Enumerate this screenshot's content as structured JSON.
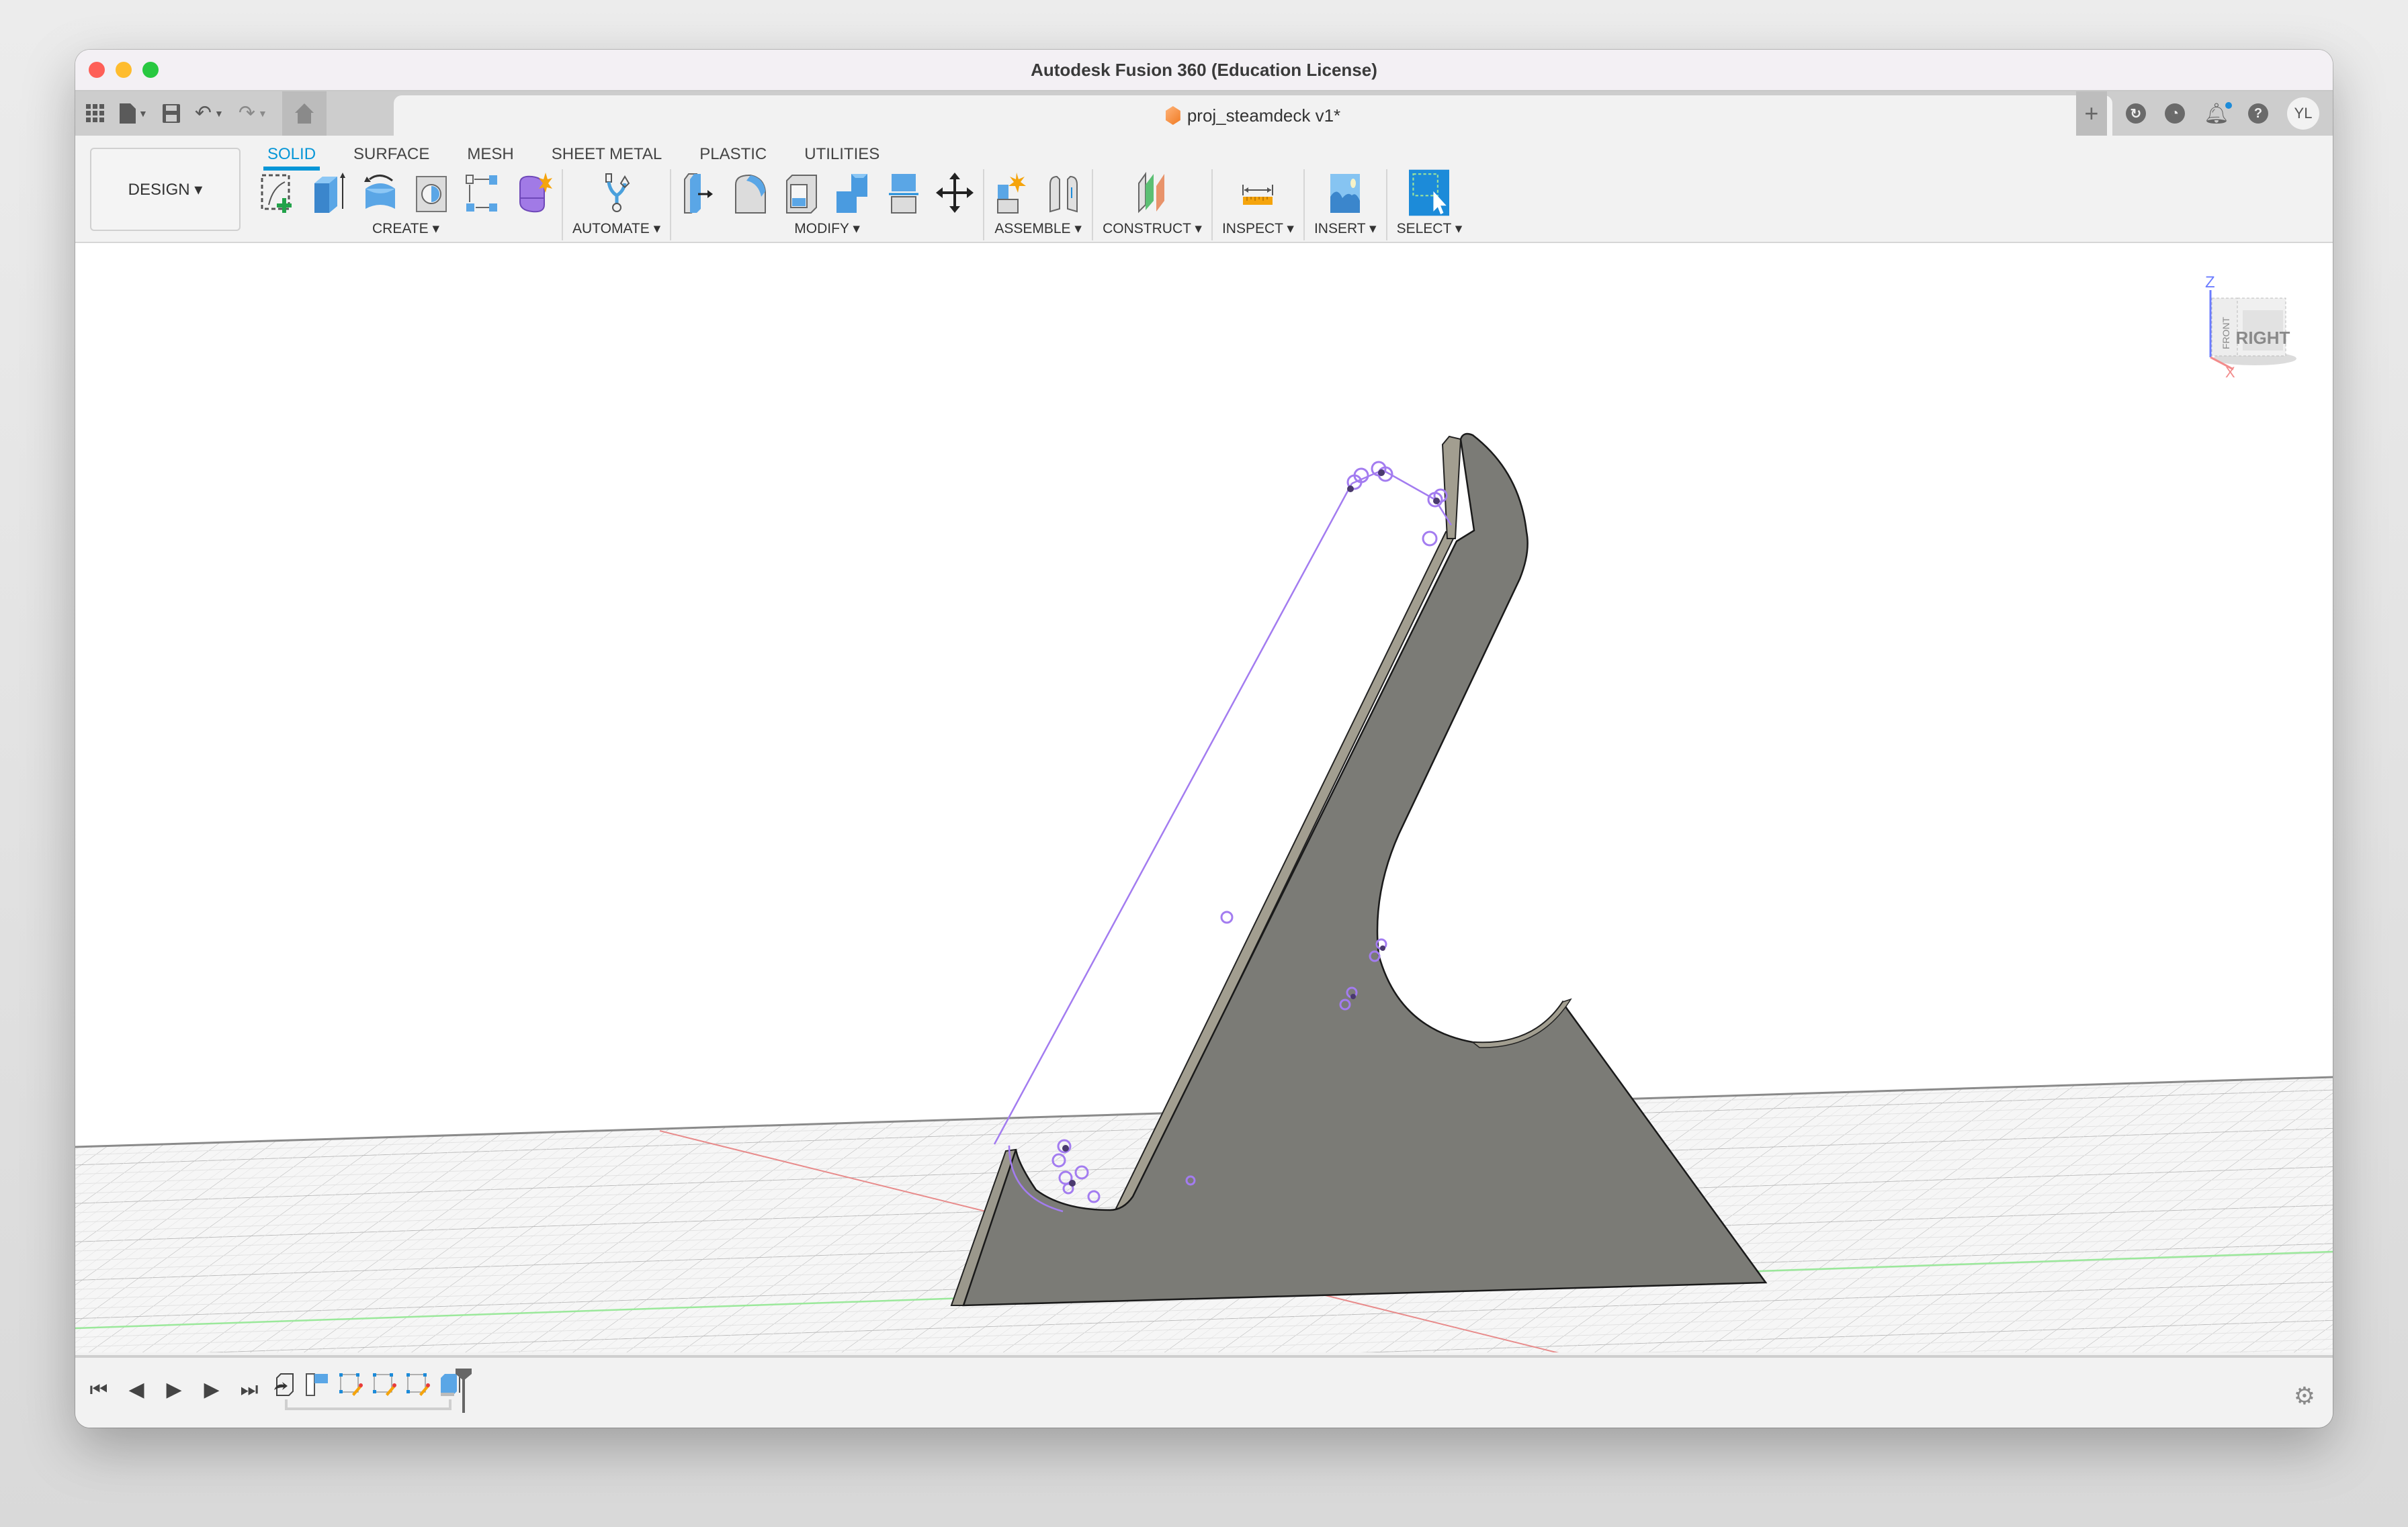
{
  "window": {
    "title": "Autodesk Fusion 360 (Education License)",
    "traffic_lights": [
      "close",
      "minimize",
      "zoom"
    ]
  },
  "tabbar": {
    "left_icons": [
      "apps-grid-icon",
      "file-icon",
      "save-icon",
      "undo-icon",
      "redo-icon"
    ],
    "home_icon": "home-icon",
    "document_tab": {
      "name": "proj_steamdeck v1*",
      "icon": "design-doc-icon"
    },
    "close_label": "×",
    "plus_label": "+",
    "right_icons": [
      "job-status-icon",
      "history-icon",
      "notifications-icon",
      "help-icon"
    ],
    "avatar_initials": "YL"
  },
  "ribbon": {
    "workspace": "DESIGN ▾",
    "tabs": [
      {
        "label": "SOLID",
        "active": true
      },
      {
        "label": "SURFACE",
        "active": false
      },
      {
        "label": "MESH",
        "active": false
      },
      {
        "label": "SHEET METAL",
        "active": false
      },
      {
        "label": "PLASTIC",
        "active": false
      },
      {
        "label": "UTILITIES",
        "active": false
      }
    ],
    "groups": [
      {
        "label": "CREATE ▾",
        "tools": [
          "create-sketch",
          "extrude",
          "revolve",
          "hole",
          "pattern",
          "create-form"
        ]
      },
      {
        "label": "AUTOMATE ▾",
        "tools": [
          "automate"
        ]
      },
      {
        "label": "MODIFY ▾",
        "tools": [
          "press-pull",
          "fillet",
          "shell",
          "combine",
          "offset-face",
          "move-copy"
        ]
      },
      {
        "label": "ASSEMBLE ▾",
        "tools": [
          "new-component",
          "joint"
        ]
      },
      {
        "label": "CONSTRUCT ▾",
        "tools": [
          "offset-plane"
        ]
      },
      {
        "label": "INSPECT ▾",
        "tools": [
          "measure"
        ]
      },
      {
        "label": "INSERT ▾",
        "tools": [
          "insert-image"
        ]
      },
      {
        "label": "SELECT ▾",
        "tools": [
          "window-select"
        ]
      }
    ],
    "accent_color": "#0696d7"
  },
  "viewport": {
    "viewcube": {
      "face_label": "RIGHT",
      "side_label": "FRONT",
      "axis_z": "Z",
      "axis_x": "X"
    },
    "model_color": "#7b7b76",
    "sketch_color": "#a37cf0",
    "nav_tools": [
      "orbit",
      "look-at",
      "pan",
      "zoom",
      "fit",
      "display-settings",
      "grid-settings",
      "viewports"
    ]
  },
  "timeline": {
    "controls": [
      "first",
      "previous",
      "play",
      "next",
      "last"
    ],
    "features": [
      "derive",
      "sketch-plane",
      "sketch",
      "sketch",
      "sketch",
      "extrude"
    ],
    "settings_icon": "gear-icon"
  }
}
